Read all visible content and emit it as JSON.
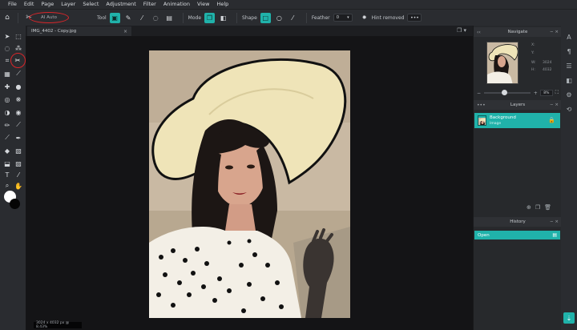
{
  "menubar": {
    "items": [
      "File",
      "Edit",
      "Page",
      "Layer",
      "Select",
      "Adjustment",
      "Filter",
      "Animation",
      "View",
      "Help"
    ]
  },
  "toolbar": {
    "ai_auto": "AI Auto",
    "tool_label": "Tool",
    "mode_label": "Mode",
    "shape_label": "Shape",
    "feather_label": "Feather",
    "feather_value": "0",
    "hint": "Hint removed",
    "ellipsis": "•••"
  },
  "document": {
    "tab_title": "IMG_4402 - Copy.jpg",
    "close_glyph": "×",
    "status_text": "3024 x 4032 px @ 8.43%"
  },
  "navigator": {
    "title": "Navigate",
    "x_label": "X:",
    "y_label": "Y:",
    "w_label": "W:",
    "h_label": "H:",
    "w_value": "3024",
    "h_value": "4032",
    "zoom": "8%"
  },
  "layers": {
    "title": "Layers",
    "items": [
      {
        "name": "Background",
        "sub": "Image"
      }
    ]
  },
  "history": {
    "title": "History",
    "items": [
      {
        "name": "Open"
      }
    ]
  },
  "panel_controls": {
    "collapse": "‹‹",
    "dots": "•••",
    "win": "− ×"
  },
  "colors": {
    "accent": "#20b2aa",
    "highlight_ring": "#d8262a",
    "chrome": "#2a2c30",
    "workspace": "#141416"
  }
}
